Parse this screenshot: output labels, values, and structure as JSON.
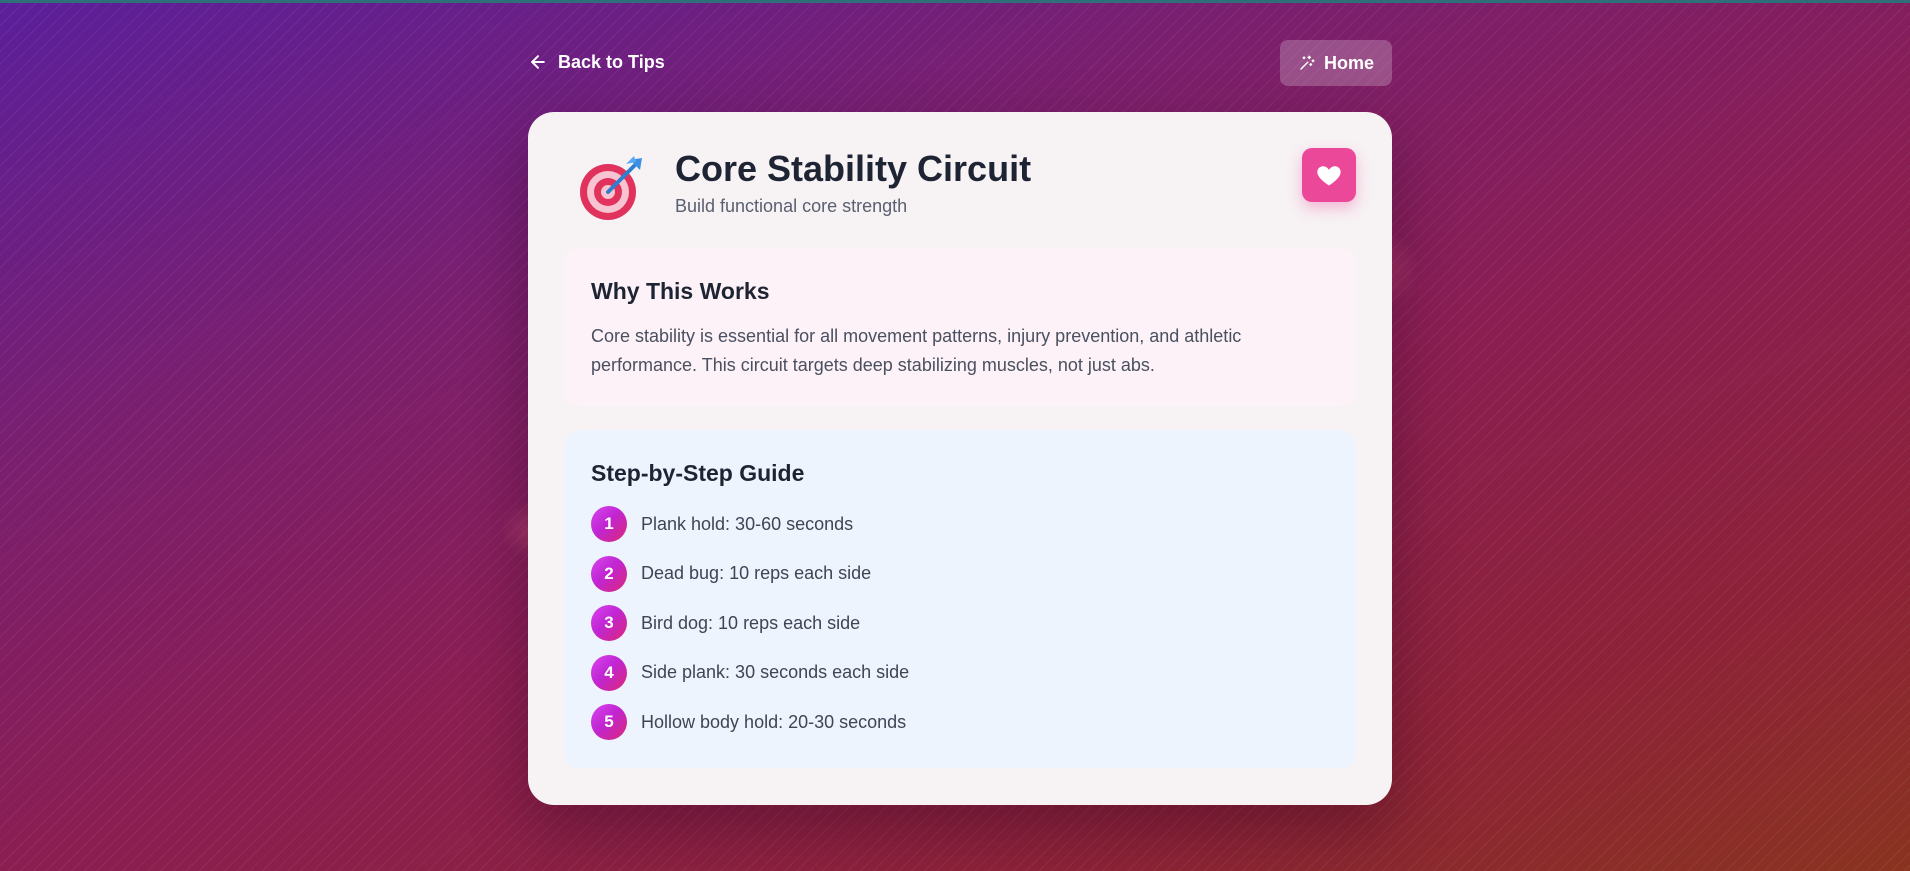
{
  "nav": {
    "back_label": "Back to Tips",
    "home_label": "Home"
  },
  "tip": {
    "icon": "target-dart-icon",
    "title": "Core Stability Circuit",
    "subtitle": "Build functional core strength"
  },
  "why": {
    "heading": "Why This Works",
    "text": "Core stability is essential for all movement patterns, injury prevention, and athletic performance. This circuit targets deep stabilizing muscles, not just abs."
  },
  "guide": {
    "heading": "Step-by-Step Guide",
    "steps": [
      {
        "num": "1",
        "text": "Plank hold: 30-60 seconds"
      },
      {
        "num": "2",
        "text": "Dead bug: 10 reps each side"
      },
      {
        "num": "3",
        "text": "Bird dog: 10 reps each side"
      },
      {
        "num": "4",
        "text": "Side plank: 30 seconds each side"
      },
      {
        "num": "5",
        "text": "Hollow body hold: 20-30 seconds"
      }
    ]
  },
  "colors": {
    "accent": "#ec4899",
    "step_gradient_start": "#d946ef",
    "step_gradient_end": "#db2777",
    "why_bg": "#fcf2f7",
    "steps_bg": "#edf4fd"
  }
}
